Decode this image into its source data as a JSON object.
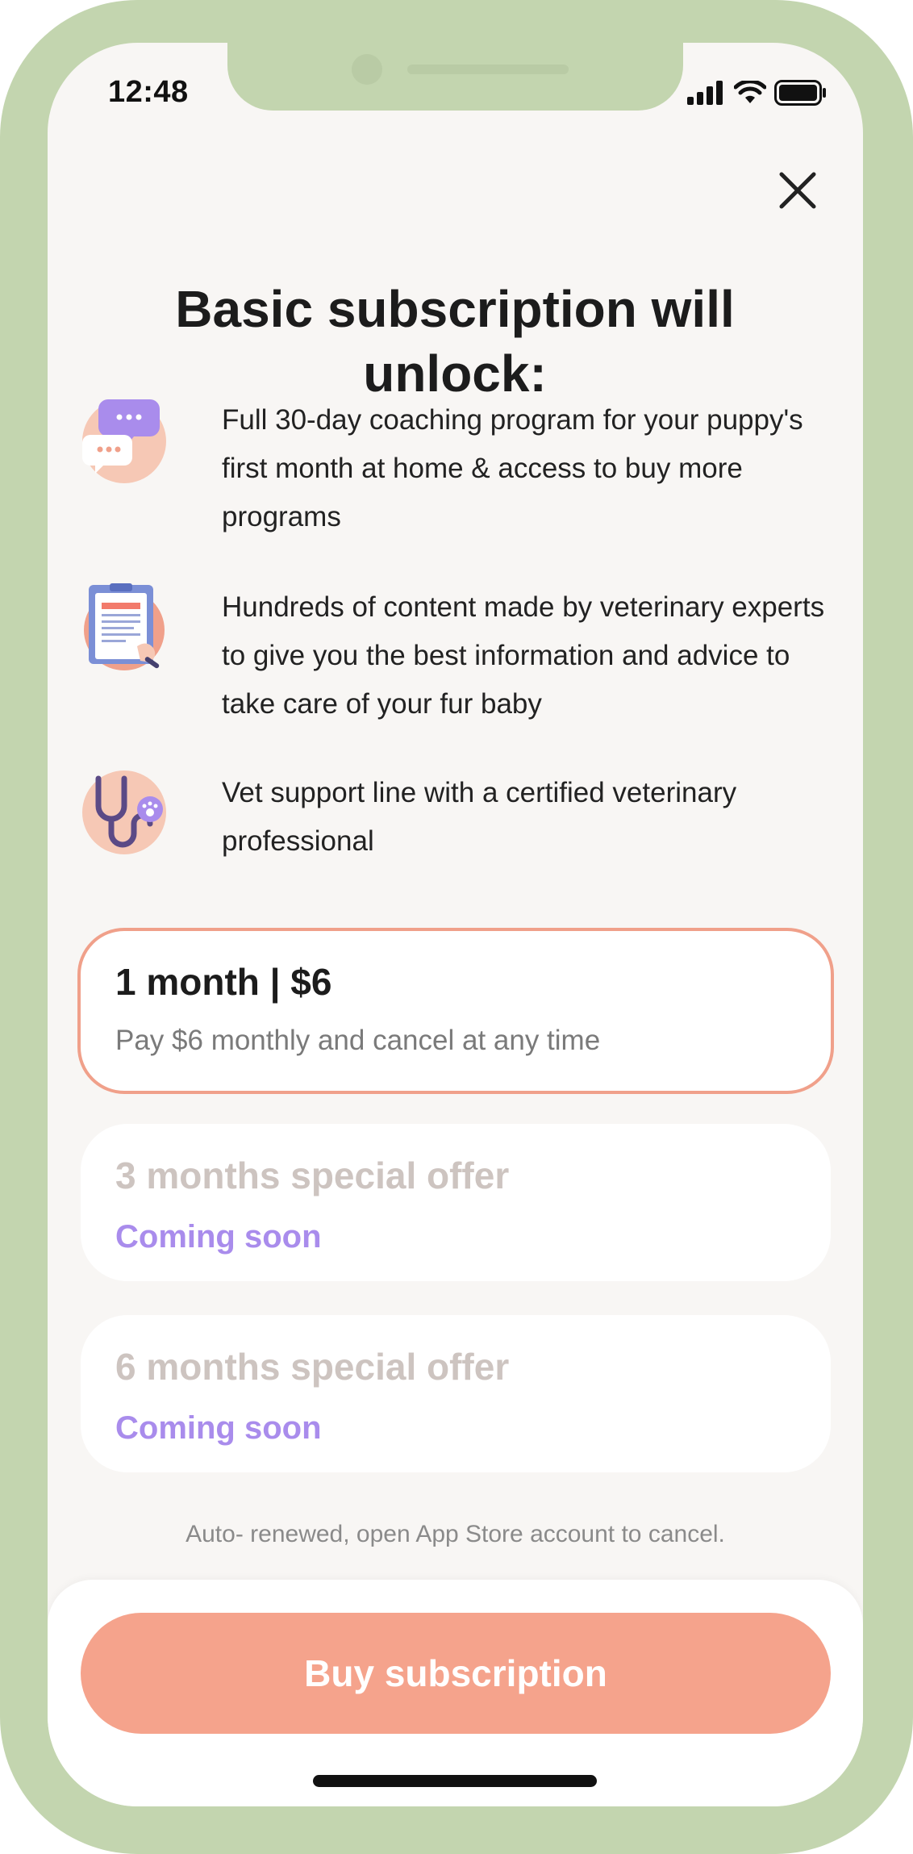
{
  "status_bar": {
    "time": "12:48",
    "icons": [
      "cellular-signal-icon",
      "wifi-icon",
      "battery-icon"
    ]
  },
  "header": {
    "close_icon": "close-icon",
    "title": "Basic subscription will unlock:"
  },
  "features": [
    {
      "icon": "chat-bubbles-icon",
      "text": "Full 30-day coaching program for your puppy's first month at home & access to buy more programs"
    },
    {
      "icon": "clipboard-document-icon",
      "text": "Hundreds of content made by veterinary experts to give you the best information and advice to take care of your fur baby"
    },
    {
      "icon": "stethoscope-paw-icon",
      "text": "Vet support line with a certified veterinary professional"
    }
  ],
  "plans": [
    {
      "title": "1 month | $6",
      "subtitle": "Pay $6 monthly and cancel at any time",
      "selected": true
    },
    {
      "title": "3 months special offer",
      "subtitle": "Coming soon",
      "selected": false
    },
    {
      "title": "6 months special offer",
      "subtitle": "Coming soon",
      "selected": false
    }
  ],
  "renew_note": "Auto- renewed, open App Store account to cancel.",
  "buy_button": "Buy subscription",
  "colors": {
    "frame": "#c3d5af",
    "screen_bg": "#f8f6f4",
    "accent": "#f5a38c",
    "selected_border": "#f0a08a",
    "coming_soon": "#a98cec",
    "disabled_title": "#cdc4c0"
  }
}
